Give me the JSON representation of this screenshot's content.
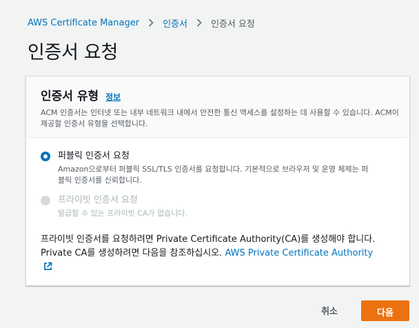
{
  "breadcrumb": {
    "items": [
      "AWS Certificate Manager",
      "인증서"
    ],
    "current": "인증서 요청"
  },
  "page": {
    "title": "인증서 요청"
  },
  "container": {
    "title": "인증서 유형",
    "info_link": "정보",
    "description": "ACM 인증서는 인터넷 또는 내부 네트워크 내에서 안전한 통신 액세스를 설정하는 데 사용할 수 있습니다. ACM이 제공할 인증서 유형을 선택합니다.",
    "options": [
      {
        "label": "퍼블릭 인증서 요청",
        "description": "Amazon으로부터 퍼블릭 SSL/TLS 인증서를 요청합니다. 기본적으로 브라우저 및 운영 체제는 퍼블릭 인증서를 신뢰합니다.",
        "selected": true,
        "disabled": false
      },
      {
        "label": "프라이빗 인증서 요청",
        "description": "발급할 수 있는 프라이빗 CA가 없습니다.",
        "selected": false,
        "disabled": true
      }
    ],
    "note_text": "프라이빗 인증서를 요청하려면 Private Certificate Authority(CA)를 생성해야 합니다. Private CA를 생성하려면 다음을 참조하십시오. ",
    "note_link": "AWS Private Certificate Authority"
  },
  "actions": {
    "cancel": "취소",
    "next": "다음"
  },
  "colors": {
    "link": "#0073bb",
    "primary_button": "#ec7211"
  }
}
